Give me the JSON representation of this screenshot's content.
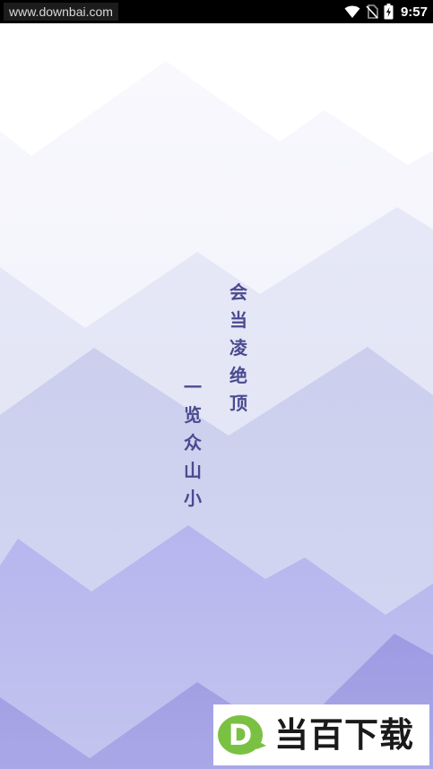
{
  "status_bar": {
    "watermark": "www.downbai.com",
    "time": "9:57",
    "icons": [
      "wifi-icon",
      "no-sim-icon",
      "battery-charging-icon"
    ]
  },
  "poem": {
    "line_1": [
      "会",
      "当",
      "凌",
      "绝",
      "顶"
    ],
    "line_2": [
      "一",
      "览",
      "众",
      "山",
      "小"
    ],
    "color": "#4b4a8f"
  },
  "brand": {
    "logo_letter": "D",
    "name": "当百下载",
    "logo_color": "#7ac143"
  },
  "colors": {
    "mountain_light": "#eef0fa",
    "mountain_mid": "#cdd1ee",
    "mountain_purple": "#b7b6ee",
    "mountain_dark": "#9b99e2"
  }
}
